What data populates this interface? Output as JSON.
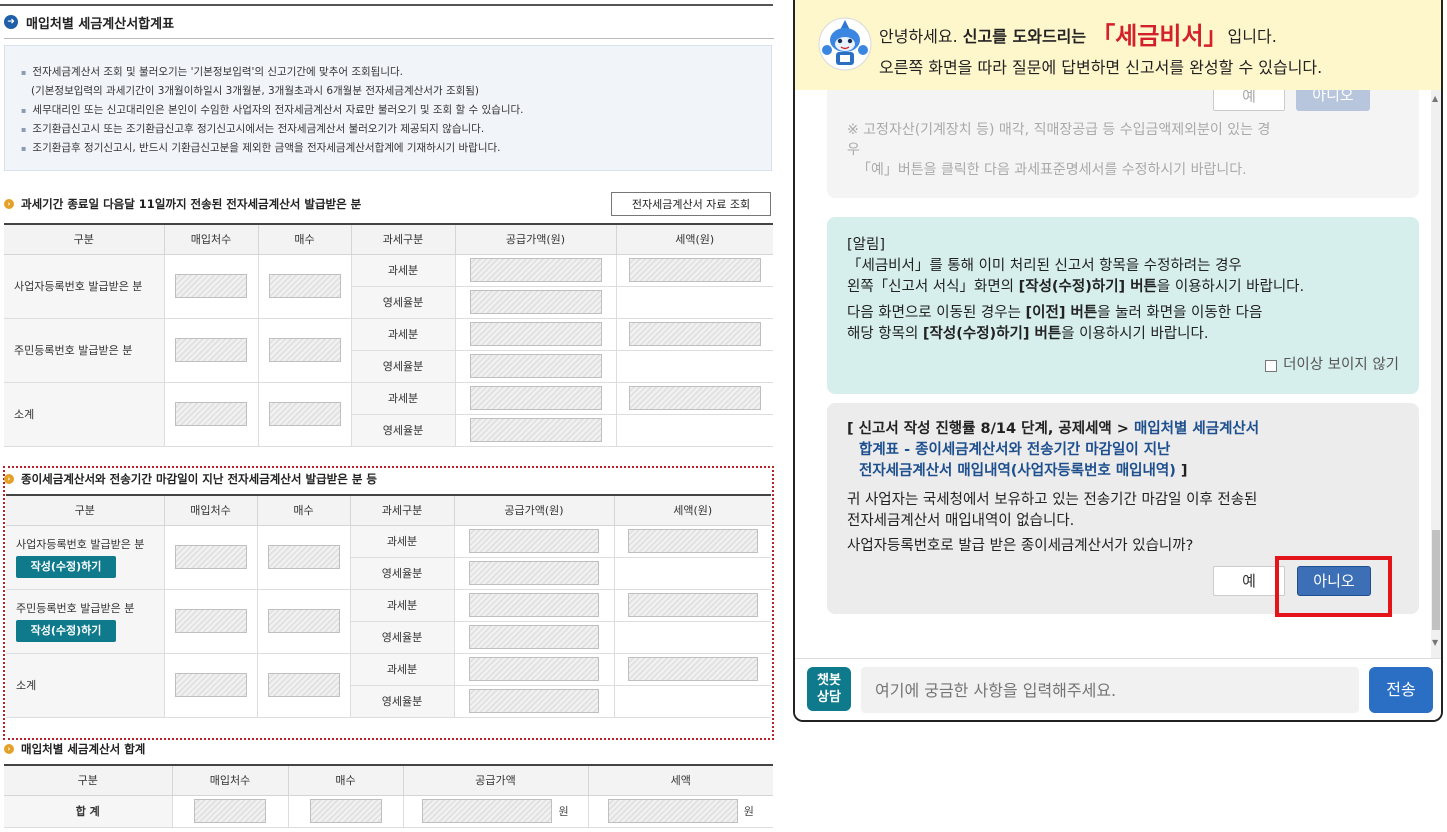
{
  "left": {
    "page_title": "매입처별 세금계산서합계표",
    "notice": [
      "전자세금계산서 조회 및 불러오기는 '기본정보입력'의 신고기간에 맞추어 조회됩니다.",
      "(기본정보입력의 과세기간이 3개월이하일시 3개월분, 3개월초과시 6개월분 전자세금계산서가 조회됨)",
      "세무대리인 또는 신고대리인은 본인이 수임한 사업자의 전자세금계산서 자료만 불러오기 및 조회 할 수 있습니다.",
      "조기환급신고시 또는 조기환급신고후 정기신고시에서는 전자세금계산서 불러오기가 제공되지 않습니다.",
      "조기환급후 정기신고시, 반드시 기환급신고분을 제외한 금액을 전자세금계산서합계에 기재하시기 바랍니다."
    ],
    "section1": {
      "title": "과세기간 종료일 다음달 11일까지 전송된 전자세금계산서 발급받은 분",
      "query_button": "전자세금계산서 자료 조회",
      "headers": [
        "구분",
        "매입처수",
        "매수",
        "과세구분",
        "공급가액(원)",
        "세액(원)"
      ],
      "rows": [
        "사업자등록번호 발급받은 분",
        "주민등록번호 발급받은 분",
        "소계"
      ]
    },
    "section2": {
      "title": "종이세금계산서와 전송기간 마감일이 지난 전자세금계산서 발급받은 분 등",
      "headers": [
        "구분",
        "매입처수",
        "매수",
        "과세구분",
        "공급가액(원)",
        "세액(원)"
      ],
      "rows": [
        "사업자등록번호 발급받은 분",
        "주민등록번호 발급받은 분",
        "소계"
      ],
      "edit_button": "작성(수정)하기"
    },
    "kind_taxable": "과세분",
    "kind_zero": "영세율분",
    "section3": {
      "title": "매입처별 세금계산서 합계",
      "headers": [
        "구분",
        "매입처수",
        "매수",
        "공급가액",
        "세액"
      ],
      "total_label": "합 계",
      "won": "원"
    }
  },
  "chat": {
    "greeting_pre": "안녕하세요. ",
    "greeting_bold": "신고를 도와드리는",
    "brand": "「세금비서」",
    "greeting_post": "입니다.",
    "subtitle": "오른쪽 화면을 따라 질문에 답변하면 신고서를 완성할 수 있습니다.",
    "old_yes": "예",
    "old_no": "아니오",
    "old_note_1": "※ 고정자산(기계장치 등) 매각, 직매장공급 등 수입금액제외분이 있는 경",
    "old_note_2": "우",
    "old_note_3": "「예」버튼을 클릭한 다음 과세표준명세서를 수정하시기 바랍니다.",
    "alert_title": "[알림]",
    "alert_l1": "「세금비서」를 통해 이미 처리된 신고서 항목을 수정하려는 경우",
    "alert_l2a": "왼쪽「신고서 서식」화면의 ",
    "alert_l2b": "[작성(수정)하기] 버튼",
    "alert_l2c": "을 이용하시기 바랍니다.",
    "alert_l3a": "다음 화면으로 이동된 경우는 ",
    "alert_l3b": "[이전] 버튼",
    "alert_l3c": "을 눌러 화면을 이동한 다음",
    "alert_l4a": "해당 항목의 ",
    "alert_l4b": "[작성(수정)하기] 버튼",
    "alert_l4c": "을 이용하시기 바랍니다.",
    "dont_show": "더이상 보이지 않기",
    "progress_a": "[ 신고서 작성 진행률 8/14 단계, 공제세액 > ",
    "progress_b": "매입처별 세금계산서",
    "progress_c": "합계표 - 종이세금계산서와 전송기간 마감일이 지난",
    "progress_d": "전자세금계산서 매입내역(사업자등록번호 매입내역)",
    "progress_e": " ]",
    "msg_1": "귀 사업자는 국세청에서 보유하고 있는 전송기간 마감일 이후 전송된",
    "msg_2": "전자세금계산서 매입내역이 없습니다.",
    "question": "사업자등록번호로 발급 받은 종이세금계산서가 있습니까?",
    "yes": "예",
    "no": "아니오",
    "bot_badge": "챗봇\n상담",
    "input_placeholder": "여기에 궁금한 사항을 입력해주세요.",
    "send": "전송"
  }
}
